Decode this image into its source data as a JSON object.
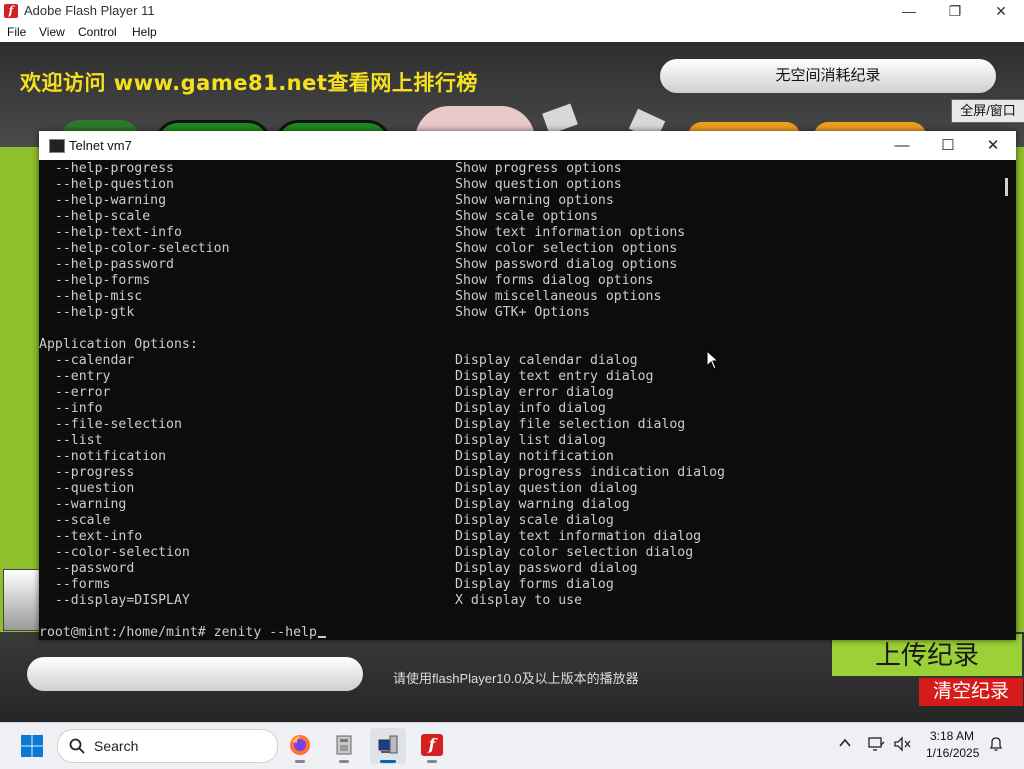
{
  "flash_window": {
    "title": "Adobe Flash Player 11",
    "menu": [
      "File",
      "View",
      "Control",
      "Help"
    ],
    "controls": {
      "minimize": "—",
      "restore": "❐",
      "close": "✕"
    }
  },
  "game": {
    "promo_text": "欢迎访问 www.game81.net查看网上排行榜",
    "panel_title": "无空间消耗纪录",
    "fullscreen_label": "全屏/窗口",
    "notice": "请使用flashPlayer10.0及以上版本的播放器",
    "upload_label": "上传纪录",
    "clear_label": "清空纪录"
  },
  "telnet": {
    "title": "Telnet vm7",
    "controls": {
      "minimize": "—",
      "maximize": "☐",
      "close": "✕"
    },
    "help_options": [
      {
        "opt": "  --help-progress",
        "desc": "Show progress options"
      },
      {
        "opt": "  --help-question",
        "desc": "Show question options"
      },
      {
        "opt": "  --help-warning",
        "desc": "Show warning options"
      },
      {
        "opt": "  --help-scale",
        "desc": "Show scale options"
      },
      {
        "opt": "  --help-text-info",
        "desc": "Show text information options"
      },
      {
        "opt": "  --help-color-selection",
        "desc": "Show color selection options"
      },
      {
        "opt": "  --help-password",
        "desc": "Show password dialog options"
      },
      {
        "opt": "  --help-forms",
        "desc": "Show forms dialog options"
      },
      {
        "opt": "  --help-misc",
        "desc": "Show miscellaneous options"
      },
      {
        "opt": "  --help-gtk",
        "desc": "Show GTK+ Options"
      }
    ],
    "section_heading": "Application Options:",
    "app_options": [
      {
        "opt": "  --calendar",
        "desc": "Display calendar dialog"
      },
      {
        "opt": "  --entry",
        "desc": "Display text entry dialog"
      },
      {
        "opt": "  --error",
        "desc": "Display error dialog"
      },
      {
        "opt": "  --info",
        "desc": "Display info dialog"
      },
      {
        "opt": "  --file-selection",
        "desc": "Display file selection dialog"
      },
      {
        "opt": "  --list",
        "desc": "Display list dialog"
      },
      {
        "opt": "  --notification",
        "desc": "Display notification"
      },
      {
        "opt": "  --progress",
        "desc": "Display progress indication dialog"
      },
      {
        "opt": "  --question",
        "desc": "Display question dialog"
      },
      {
        "opt": "  --warning",
        "desc": "Display warning dialog"
      },
      {
        "opt": "  --scale",
        "desc": "Display scale dialog"
      },
      {
        "opt": "  --text-info",
        "desc": "Display text information dialog"
      },
      {
        "opt": "  --color-selection",
        "desc": "Display color selection dialog"
      },
      {
        "opt": "  --password",
        "desc": "Display password dialog"
      },
      {
        "opt": "  --forms",
        "desc": "Display forms dialog"
      },
      {
        "opt": "  --display=DISPLAY",
        "desc": "X display to use"
      }
    ],
    "prompt": "root@mint:/home/mint# zenity --help"
  },
  "taskbar": {
    "search_label": "Search",
    "apps": [
      "firefox-icon",
      "file-manager-icon",
      "telnet-icon",
      "flash-player-icon"
    ],
    "active_app": "telnet-icon",
    "time": "3:18 AM",
    "date": "1/16/2025"
  },
  "colors": {
    "stage_green": "#8fbf2a",
    "promo_yellow": "#f5e020",
    "terminal_bg": "#0c0c0c",
    "terminal_text": "#cccccc",
    "clear_red": "#d61b1b",
    "accent_blue": "#0067c0"
  }
}
